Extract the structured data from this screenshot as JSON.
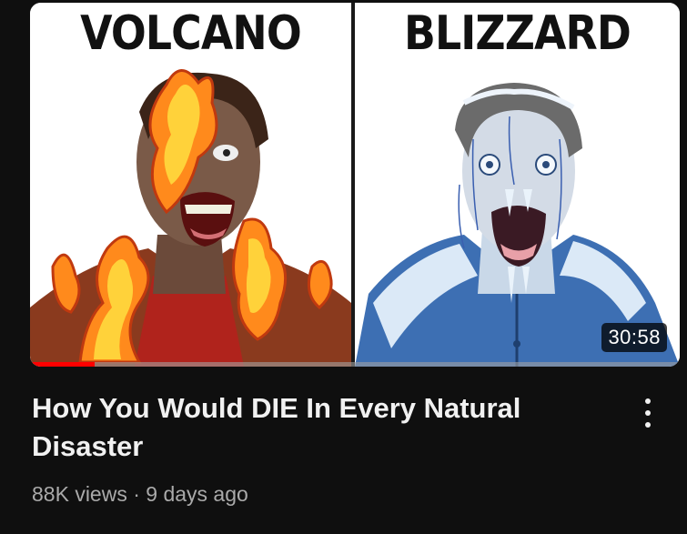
{
  "video": {
    "thumbnail": {
      "left_label": "VOLCANO",
      "right_label": "BLIZZARD",
      "duration": "30:58",
      "watch_progress": 0.1
    },
    "title": "How You Would DIE In Every Natural Disaster",
    "meta": "88K views · 9 days ago",
    "more_icon": "more-vertical-icon"
  },
  "colors": {
    "background": "#0f0f0f",
    "title_text": "#f1f1f1",
    "meta_text": "#aaaaaa",
    "progress": "#ff0000"
  }
}
